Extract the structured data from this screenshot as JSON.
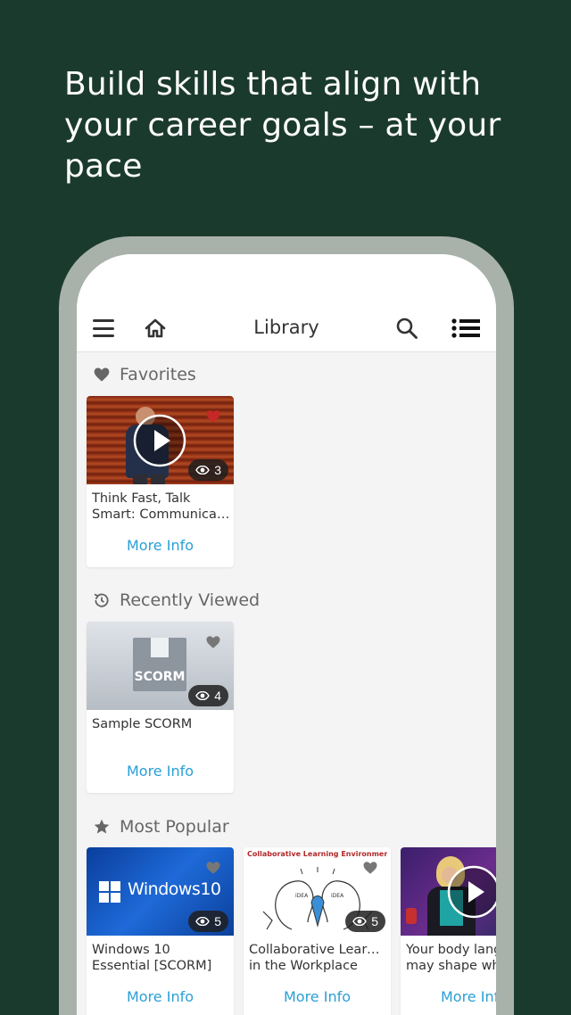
{
  "headline": "Build skills that align with your career goals – at your pace",
  "nav": {
    "title": "Library"
  },
  "sections": [
    {
      "title": "Favorites",
      "icon": "heart-icon"
    },
    {
      "title": "Recently Viewed",
      "icon": "history-icon"
    },
    {
      "title": "Most Popular",
      "icon": "star-icon"
    }
  ],
  "cards": {
    "favorite": {
      "title_line1": "Think Fast, Talk",
      "title_line2": "Smart: Communicati...",
      "views": "3",
      "more": "More Info",
      "favorited": true
    },
    "recent": {
      "title_line1": "Sample SCORM",
      "title_line2": "",
      "views": "4",
      "more": "More Info",
      "thumb_text": "SCORM"
    },
    "popular": [
      {
        "title_line1": "Windows 10",
        "title_line2": "Essential [SCORM]",
        "views": "5",
        "more": "More Info",
        "thumb_text": "Windows10"
      },
      {
        "title_line1": "Collaborative Learning",
        "title_line2": "in the Workplace",
        "views": "5",
        "more": "More Info",
        "thumb_text": "Collaborative Learning Environment"
      },
      {
        "title_line1": "Your body lang",
        "title_line2": "may shape who",
        "views": "",
        "more": "More Info"
      }
    ]
  },
  "colors": {
    "background": "#1b3a2e",
    "frame": "#a8b2ab",
    "link": "#2a9fd6",
    "favorite": "#c62828"
  }
}
